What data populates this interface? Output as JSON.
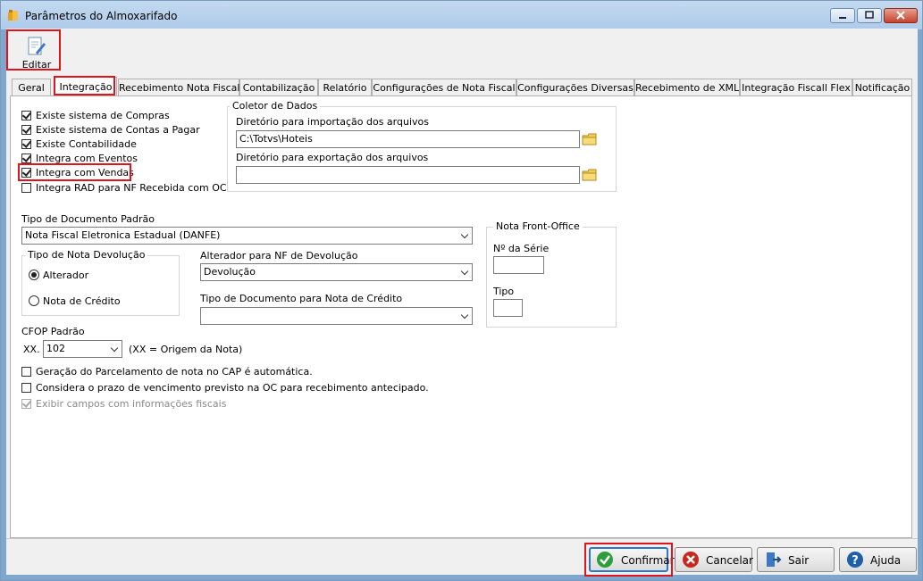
{
  "window": {
    "title": "Parâmetros do Almoxarifado"
  },
  "toolbar": {
    "edit_label": "Editar"
  },
  "tabs": [
    {
      "label": "Geral"
    },
    {
      "label": "Integração"
    },
    {
      "label": "Recebimento Nota Fiscal"
    },
    {
      "label": "Contabilização"
    },
    {
      "label": "Relatório"
    },
    {
      "label": "Configurações de Nota Fiscal"
    },
    {
      "label": "Configurações Diversas"
    },
    {
      "label": "Recebimento de XML"
    },
    {
      "label": "Integração Fiscall Flex"
    },
    {
      "label": "Notificação"
    }
  ],
  "integration_checks": [
    {
      "label": "Existe sistema de Compras",
      "checked": true
    },
    {
      "label": "Existe sistema de Contas a Pagar",
      "checked": true
    },
    {
      "label": "Existe Contabilidade",
      "checked": true
    },
    {
      "label": "Integra com Eventos",
      "checked": true
    },
    {
      "label": "Integra com Vendas",
      "checked": true
    },
    {
      "label": "Integra RAD para NF Recebida com OC",
      "checked": false
    }
  ],
  "coletor": {
    "title": "Coletor de Dados",
    "import_label": "Diretório para importação dos arquivos",
    "import_value": "C:\\Totvs\\Hoteis",
    "export_label": "Diretório para exportação dos arquivos",
    "export_value": ""
  },
  "tipo_documento": {
    "label": "Tipo de Documento Padrão",
    "value": "Nota Fiscal Eletronica Estadual (DANFE)"
  },
  "tipo_nota_devolucao": {
    "title": "Tipo de Nota Devolução",
    "options": [
      {
        "label": "Alterador",
        "selected": true
      },
      {
        "label": "Nota de Crédito",
        "selected": false
      }
    ]
  },
  "alterador_nf": {
    "label": "Alterador para NF de Devolução",
    "value": "Devolução"
  },
  "tipo_doc_credito": {
    "label": "Tipo de Documento para Nota de Crédito",
    "value": ""
  },
  "front_office": {
    "title": "Nota Front-Office",
    "serie_label": "Nº da Série",
    "serie_value": "",
    "tipo_label": "Tipo",
    "tipo_value": ""
  },
  "cfop": {
    "label": "CFOP Padrão",
    "prefix": "XX.",
    "value": "102",
    "hint": "(XX = Origem da Nota)"
  },
  "bottom_checks": [
    {
      "label": "Geração do Parcelamento de nota no CAP é automática.",
      "checked": false,
      "disabled": false
    },
    {
      "label": "Considera o prazo de vencimento previsto na OC para recebimento antecipado.",
      "checked": false,
      "disabled": false
    },
    {
      "label": "Exibir campos com informações fiscais",
      "checked": true,
      "disabled": true
    }
  ],
  "buttons": {
    "confirmar": "Confirmar",
    "cancelar": "Cancelar",
    "sair": "Sair",
    "ajuda": "Ajuda"
  },
  "colors": {
    "highlight": "#e0141e",
    "confirm": "#2e9e3c",
    "cancel": "#c9261d",
    "help": "#1f5fa8"
  }
}
